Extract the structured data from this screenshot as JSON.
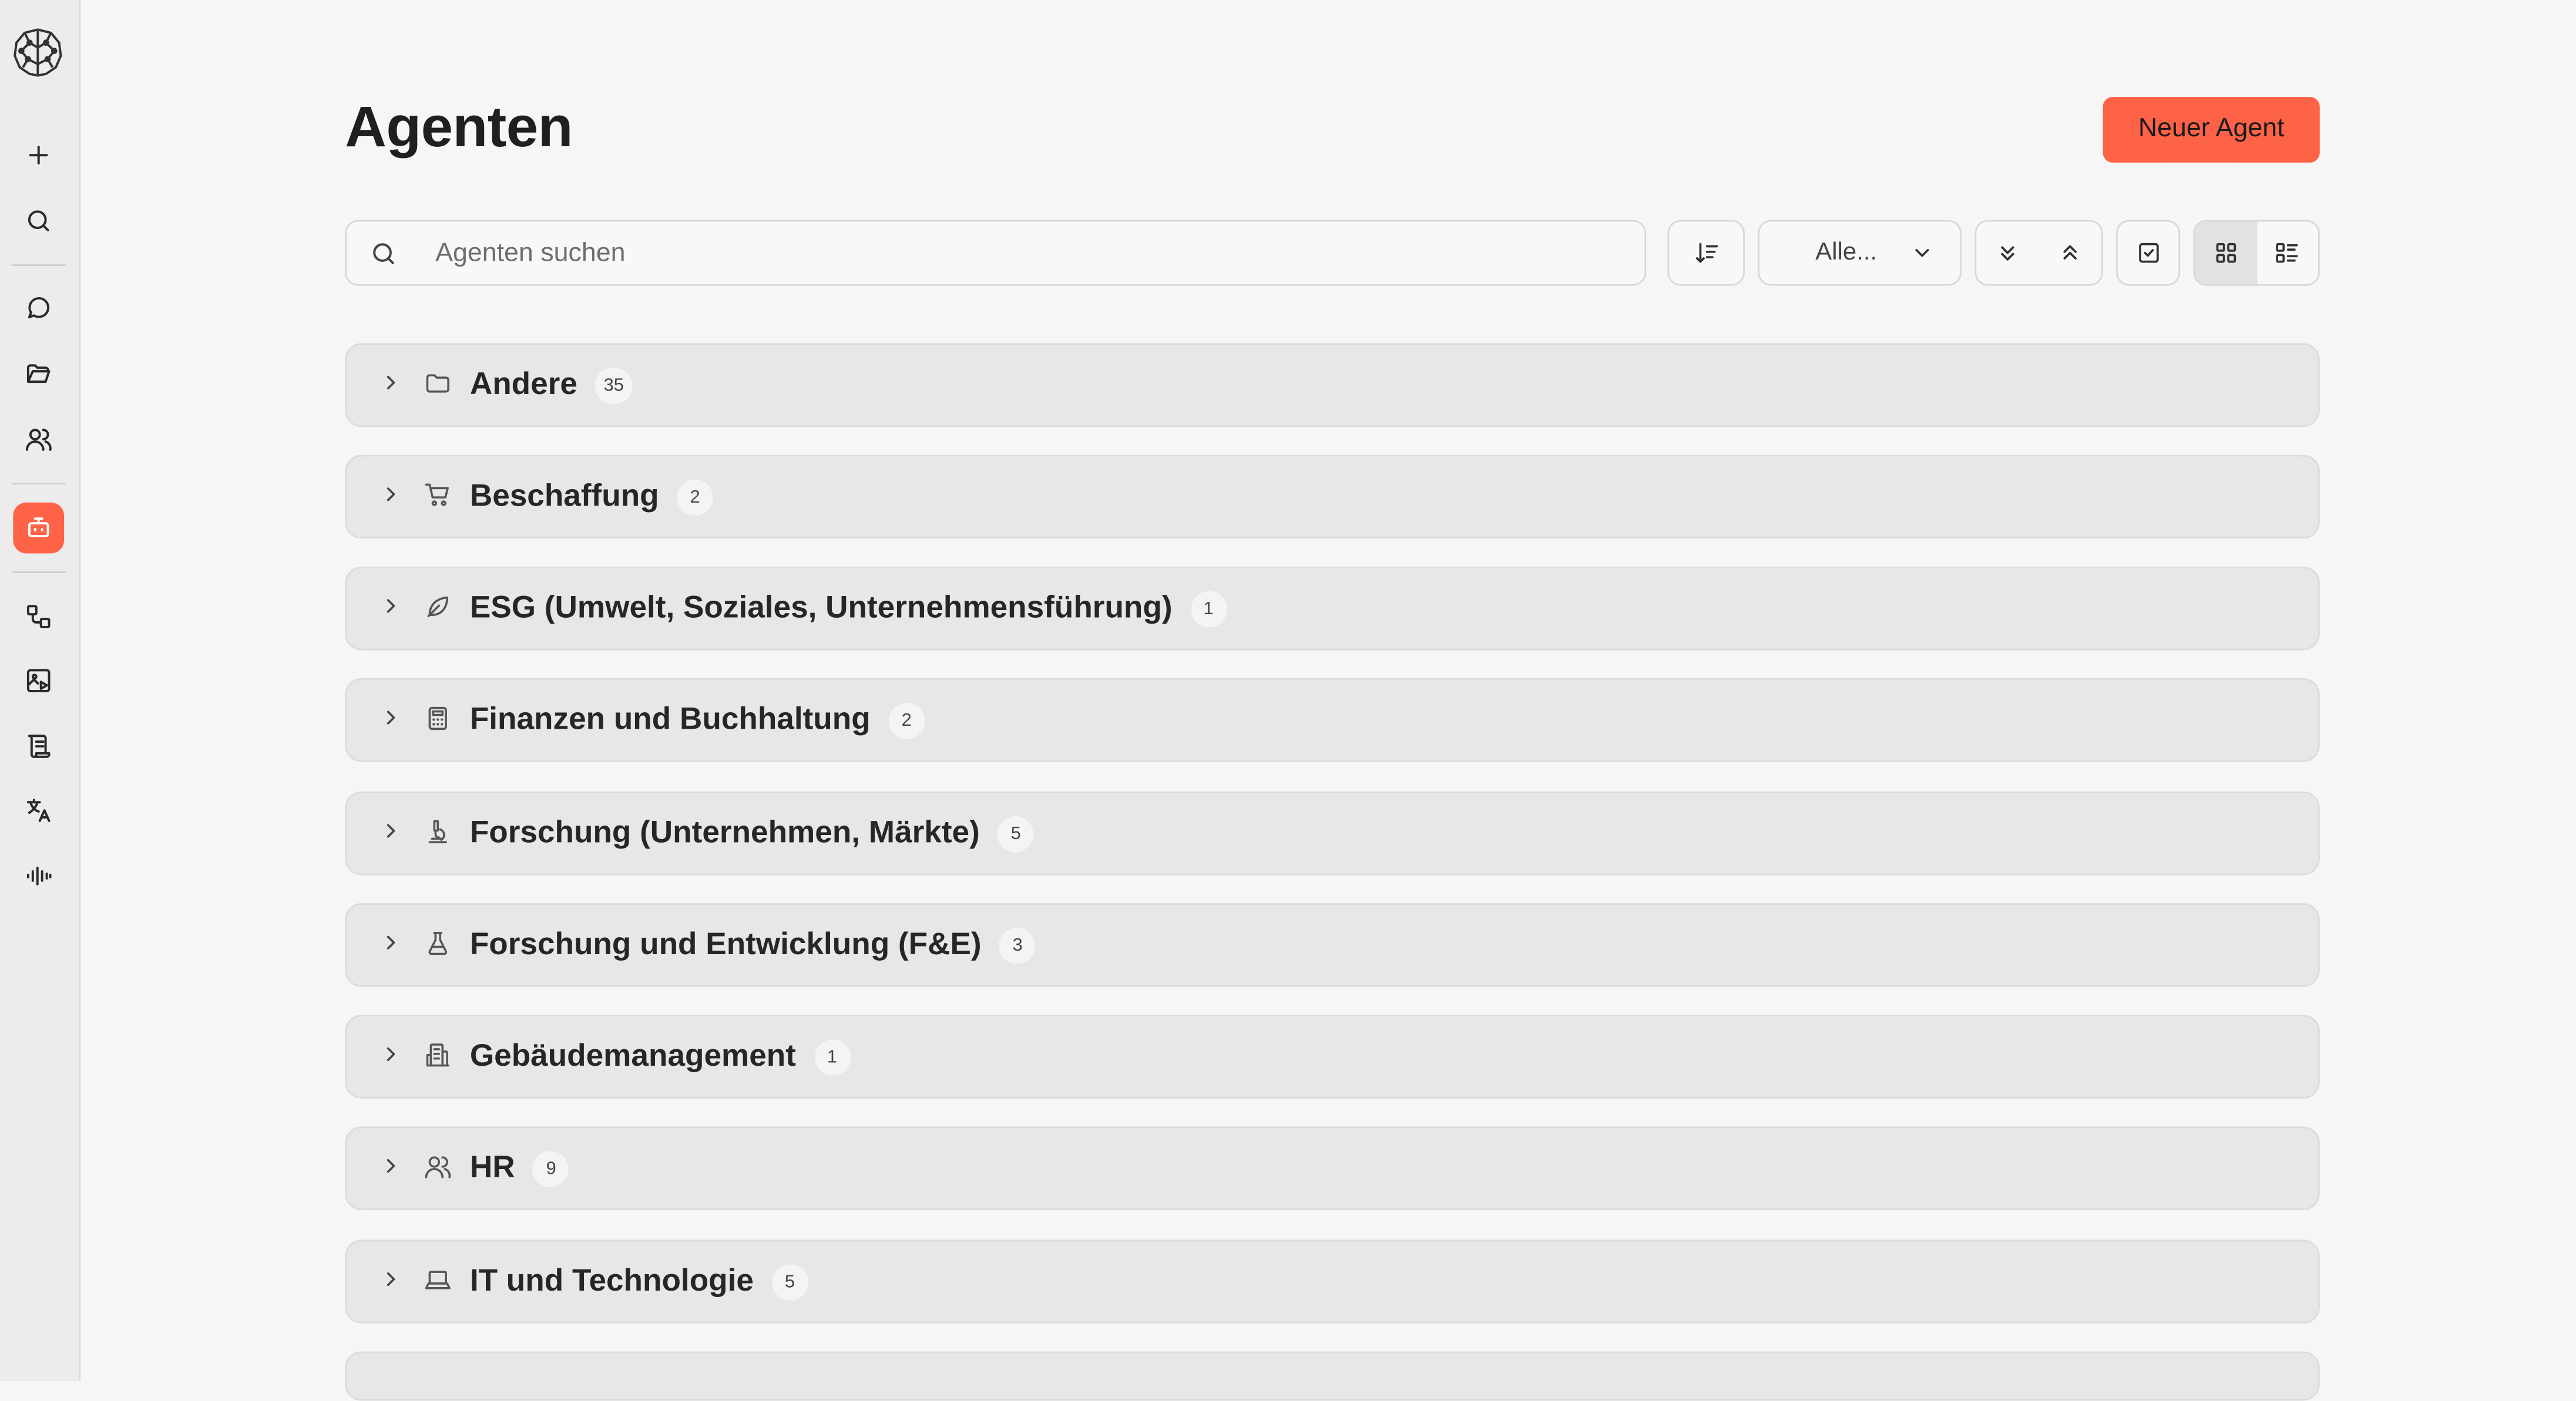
{
  "header": {
    "title": "Agenten",
    "new_agent_label": "Neuer Agent"
  },
  "toolbar": {
    "search_placeholder": "Agenten suchen",
    "filter_value": "Alle..."
  },
  "colors": {
    "accent": "#ff6347",
    "row_bg": "#e7e7e7",
    "page_bg": "#f6f6f6"
  },
  "sidebar": {
    "icons": [
      "brain-logo-icon",
      "plus-icon",
      "search-icon",
      "chat-icon",
      "folder-icon",
      "users-icon",
      "bot-icon",
      "workflow-icon",
      "image-play-icon",
      "scroll-icon",
      "translate-icon",
      "audio-waveform-icon"
    ]
  },
  "categories": [
    {
      "label": "Andere",
      "count": "35",
      "icon": "folder-icon"
    },
    {
      "label": "Beschaffung",
      "count": "2",
      "icon": "shopping-cart-icon"
    },
    {
      "label": "ESG (Umwelt, Soziales, Unternehmensführung)",
      "count": "1",
      "icon": "leaf-icon"
    },
    {
      "label": "Finanzen und Buchhaltung",
      "count": "2",
      "icon": "calculator-icon"
    },
    {
      "label": "Forschung (Unternehmen, Märkte)",
      "count": "5",
      "icon": "microscope-icon"
    },
    {
      "label": "Forschung und Entwicklung (F&E)",
      "count": "3",
      "icon": "flask-icon"
    },
    {
      "label": "Gebäudemanagement",
      "count": "1",
      "icon": "building-icon"
    },
    {
      "label": "HR",
      "count": "9",
      "icon": "users-icon"
    },
    {
      "label": "IT und Technologie",
      "count": "5",
      "icon": "laptop-icon"
    }
  ]
}
